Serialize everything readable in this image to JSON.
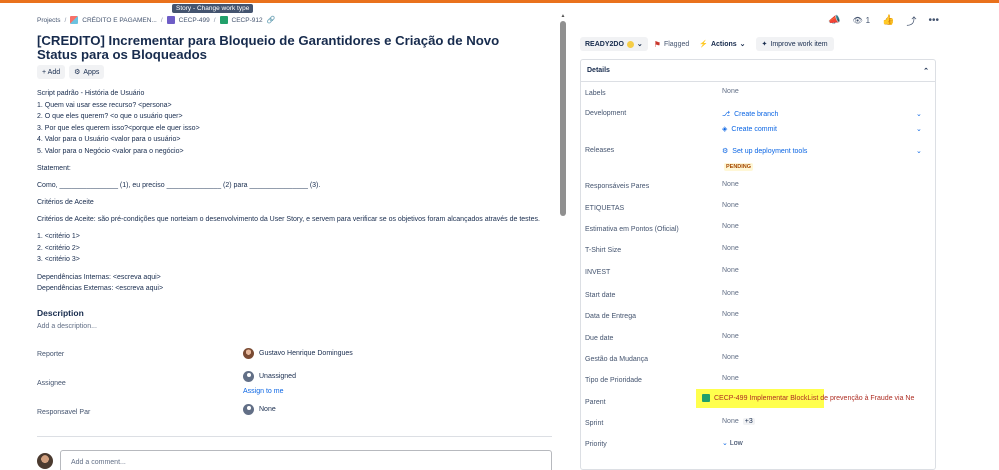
{
  "tooltip": "Story - Change work type",
  "breadcrumb": {
    "projects": "Projects",
    "project": "CRÉDITO E PAGAMEN...",
    "epic": "CECP-499",
    "issue": "CECP-912"
  },
  "issue_title": "[CREDITO] Incrementar para Bloqueio de Garantidores e Criação de Novo Status para os Bloqueados",
  "actions": {
    "add": "+ Add",
    "apps": "Apps"
  },
  "description_body": [
    "Script padrão - História de Usuário",
    "1. Quem vai usar esse recurso? <persona>",
    "2. O que eles querem? <o que o usuário quer>",
    "3. Por que eles querem isso?<porque ele quer isso>",
    "4. Valor para o Usuário <valor para o usuário>",
    "5. Valor para o Negócio <valor para o negócio>",
    "",
    "Statement:",
    "",
    "Como, _______________ (1), eu preciso ______________ (2) para _______________ (3).",
    "",
    "Critérios de Aceite",
    "",
    "Critérios de Aceite: são pré-condições que norteiam o desenvolvimento da User Story, e servem para verificar se os objetivos foram alcançados através de testes.",
    "",
    "1. <critério 1>",
    "2. <critério 2>",
    "3. <critério 3>",
    "",
    "Dependências Internas: <escreva aqui>",
    "Dependências Externas: <escreva aqui>"
  ],
  "description": {
    "heading": "Description",
    "placeholder": "Add a description..."
  },
  "people": {
    "reporter_label": "Reporter",
    "reporter_value": "Gustavo Henrique Domingues",
    "assignee_label": "Assignee",
    "assignee_value": "Unassigned",
    "assign_to_me": "Assign to me",
    "responsavel_label": "Responsavel Par",
    "responsavel_value": "None"
  },
  "comment": {
    "placeholder": "Add a comment..."
  },
  "right_header": {
    "watch_count": "1"
  },
  "status": {
    "label": "READY2DO",
    "flagged": "Flagged",
    "actions": "Actions",
    "improve": "Improve work item"
  },
  "details": {
    "heading": "Details",
    "labels": {
      "label": "Labels",
      "value": "None"
    },
    "development": {
      "label": "Development",
      "create_branch": "Create branch",
      "create_commit": "Create commit"
    },
    "releases": {
      "label": "Releases",
      "setup": "Set up deployment tools",
      "badge": "PENDING"
    },
    "responsaveis": {
      "label": "Responsáveis Pares",
      "value": "None"
    },
    "etiquetas": {
      "label": "ETIQUETAS",
      "value": "None"
    },
    "estimativa": {
      "label": "Estimativa em Pontos (Oficial)",
      "value": "None"
    },
    "tshirt": {
      "label": "T-Shirt Size",
      "value": "None"
    },
    "invest": {
      "label": "INVEST",
      "value": "None"
    },
    "start_date": {
      "label": "Start date",
      "value": "None"
    },
    "data_entrega": {
      "label": "Data de Entrega",
      "value": "None"
    },
    "due_date": {
      "label": "Due date",
      "value": "None"
    },
    "gestao": {
      "label": "Gestão da Mudança",
      "value": "None"
    },
    "tipo_prioridade": {
      "label": "Tipo de Prioridade",
      "value": "None"
    },
    "parent": {
      "label": "Parent",
      "value": "CECP-499 Implementar BlockList de prevenção à Fraude via Ne"
    },
    "sprint": {
      "label": "Sprint",
      "value": "None",
      "extra": "+3"
    },
    "priority": {
      "label": "Priority",
      "value": "Low"
    }
  },
  "colors": {
    "accent_bar": "#e9711c",
    "link": "#0c66e4",
    "highlight": "#ffff2e"
  }
}
